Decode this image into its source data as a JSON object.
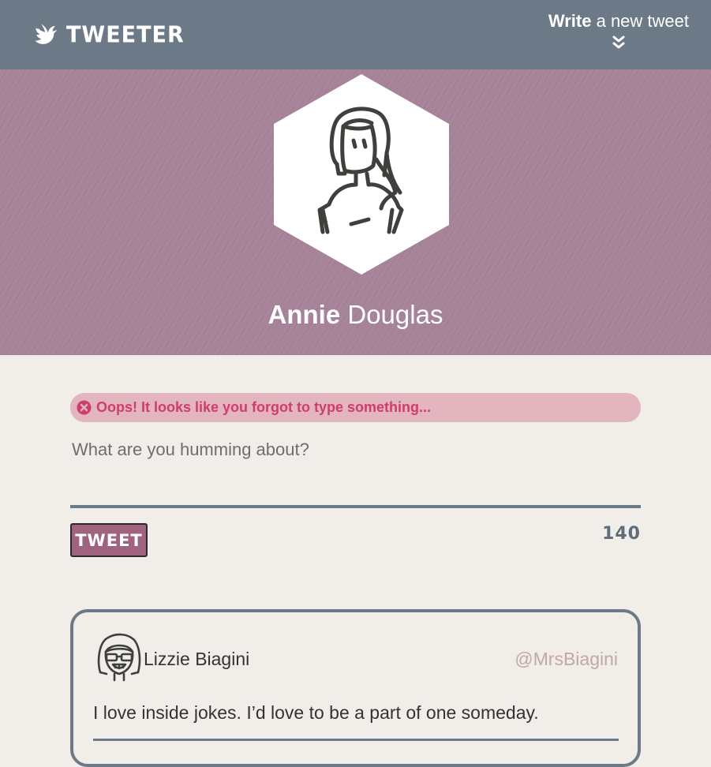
{
  "nav": {
    "brand": "TWEETER",
    "compose_strong": "Write",
    "compose_rest": " a new tweet"
  },
  "profile": {
    "first_name": "Annie",
    "last_name": " Douglas"
  },
  "composer": {
    "error_message": "Oops! It looks like you forgot to type something...",
    "placeholder": "What are you humming about?",
    "tweet_button": "TWEET",
    "char_count": "140"
  },
  "tweets": [
    {
      "author": "Lizzie Biagini",
      "handle": "@MrsBiagini",
      "body": "I love inside jokes. I’d love to be a part of one someday."
    }
  ],
  "colors": {
    "nav": "#6c7a88",
    "hero": "#a68398",
    "accent": "#a0637f",
    "error_bg": "#e2b5bf",
    "error_text": "#cf3d6c",
    "page_bg": "#f1eee9"
  },
  "icons": {
    "brand": "bird-icon",
    "compose": "double-chevron-down-icon",
    "error": "error-circle-icon"
  }
}
